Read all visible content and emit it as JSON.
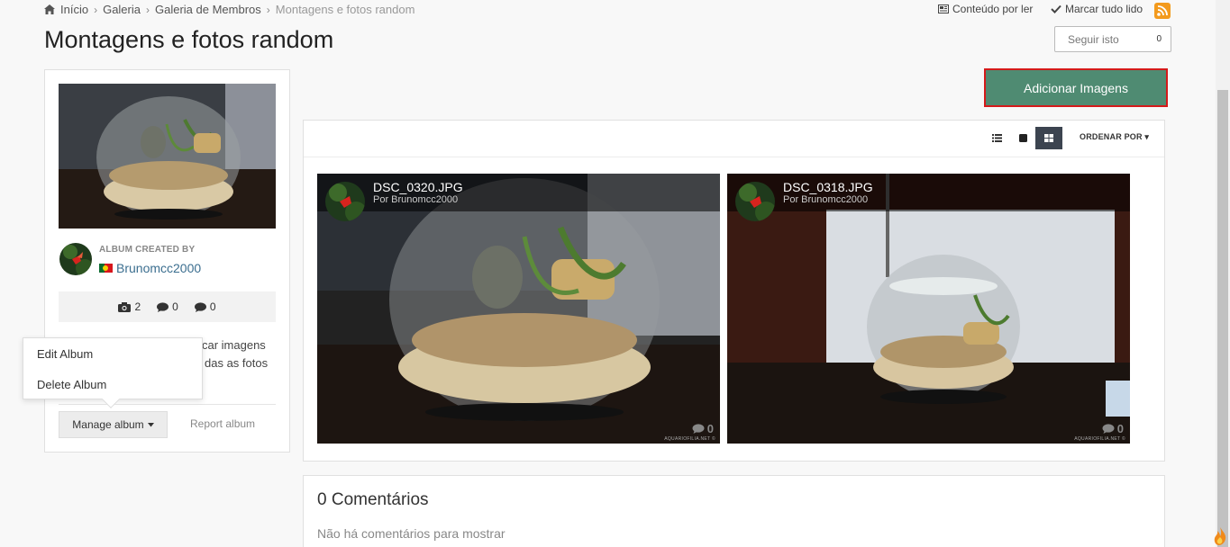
{
  "breadcrumb": {
    "items": [
      "Início",
      "Galeria",
      "Galeria de Membros"
    ],
    "current": "Montagens e fotos random"
  },
  "top_actions": {
    "unread": "Conteúdo por ler",
    "mark_read": "Marcar tudo lido"
  },
  "page": {
    "title": "Montagens e fotos random"
  },
  "follow": {
    "label": "Seguir isto",
    "count": "0"
  },
  "album": {
    "created_by_label": "ALBUM CREATED BY",
    "creator": "Brunomcc2000",
    "stats": {
      "images": "2",
      "comments": "0",
      "reviews": "0"
    },
    "description_line1": "car imagens",
    "description_line2": "das as fotos",
    "manage_label": "Manage album",
    "report_label": "Report album"
  },
  "manage_menu": {
    "items": [
      "Edit Album",
      "Delete Album"
    ]
  },
  "add_images_label": "Adicionar Imagens",
  "toolbar": {
    "sort_label": "ORDENAR POR"
  },
  "photos": [
    {
      "title": "DSC_0320.JPG",
      "author": "Por Brunomcc2000",
      "comments": "0",
      "watermark": "AQUARIOFILIA.NET ©"
    },
    {
      "title": "DSC_0318.JPG",
      "author": "Por Brunomcc2000",
      "comments": "0",
      "watermark": "AQUARIOFILIA.NET ©"
    }
  ],
  "comments": {
    "title": "0 Comentários",
    "empty": "Não há comentários para mostrar"
  },
  "colors": {
    "accent_green": "#4f8b72",
    "highlight_red": "#d41a1a",
    "link_blue": "#3b6e8f",
    "rss_orange": "#f39a1d"
  }
}
